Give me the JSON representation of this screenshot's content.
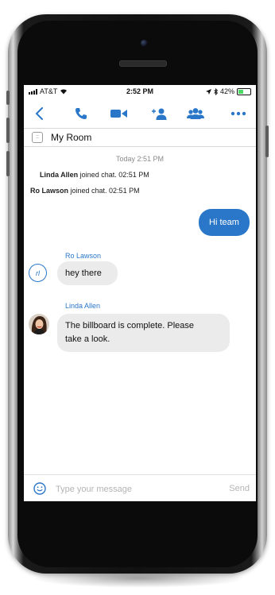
{
  "status_bar": {
    "carrier": "AT&T",
    "time": "2:52 PM",
    "battery": "42%",
    "battery_level": 0.42
  },
  "toolbar": {
    "icons": [
      "back-icon",
      "phone-icon",
      "video-icon",
      "add-person-icon",
      "participants-icon",
      "more-icon"
    ]
  },
  "room": {
    "title": "My Room"
  },
  "chat": {
    "date_header": "Today 2:51 PM",
    "system_events": [
      {
        "name": "Linda Allen",
        "text": " joined chat. 02:51 PM"
      },
      {
        "name": "Ro Lawson",
        "text": " joined chat. 02:51 PM"
      }
    ],
    "outgoing": {
      "text": "Hi team"
    },
    "incoming": [
      {
        "sender": "Ro Lawson",
        "initials": "rl",
        "lines": [
          "hey there"
        ]
      },
      {
        "sender": "Linda Allen",
        "lines": [
          "The billboard is complete. Please",
          "take a look."
        ]
      }
    ]
  },
  "composer": {
    "placeholder": "Type your message",
    "send_label": "Send"
  },
  "colors": {
    "accent": "#2a77c9",
    "incoming_bubble": "#ebebeb",
    "battery_fill": "#4cd964"
  }
}
